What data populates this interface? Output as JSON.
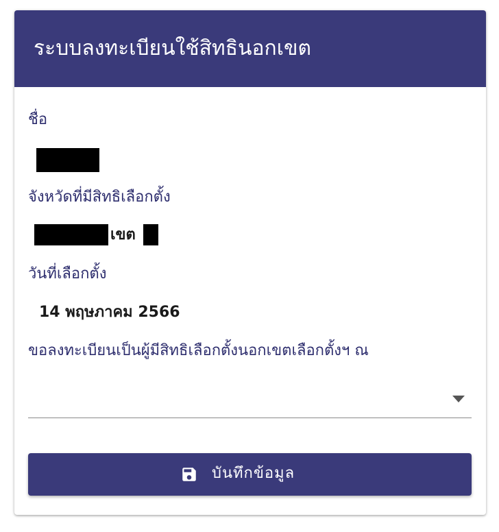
{
  "form": {
    "title": "ระบบลงทะเบียนใช้สิทธินอกเขต",
    "name_label": "ชื่อ",
    "province_label": "จังหวัดที่มีสิทธิเลือกตั้ง",
    "district_text": "เขต",
    "date_label": "วันที่เลือกตั้ง",
    "date_value": "14 พฤษภาคม 2566",
    "location_label": "ขอลงทะเบียนเป็นผู้มีสิทธิเลือกตั้งนอกเขตเลือกตั้งฯ ณ",
    "location_value": "",
    "save_label": "บันทึกข้อมูล"
  },
  "icons": {
    "dropdown": "triangle-down-icon",
    "save": "floppy-disk-icon"
  },
  "colors": {
    "primary": "#3a3a7a",
    "label_text": "#2e2e6e",
    "redaction": "#000000"
  }
}
